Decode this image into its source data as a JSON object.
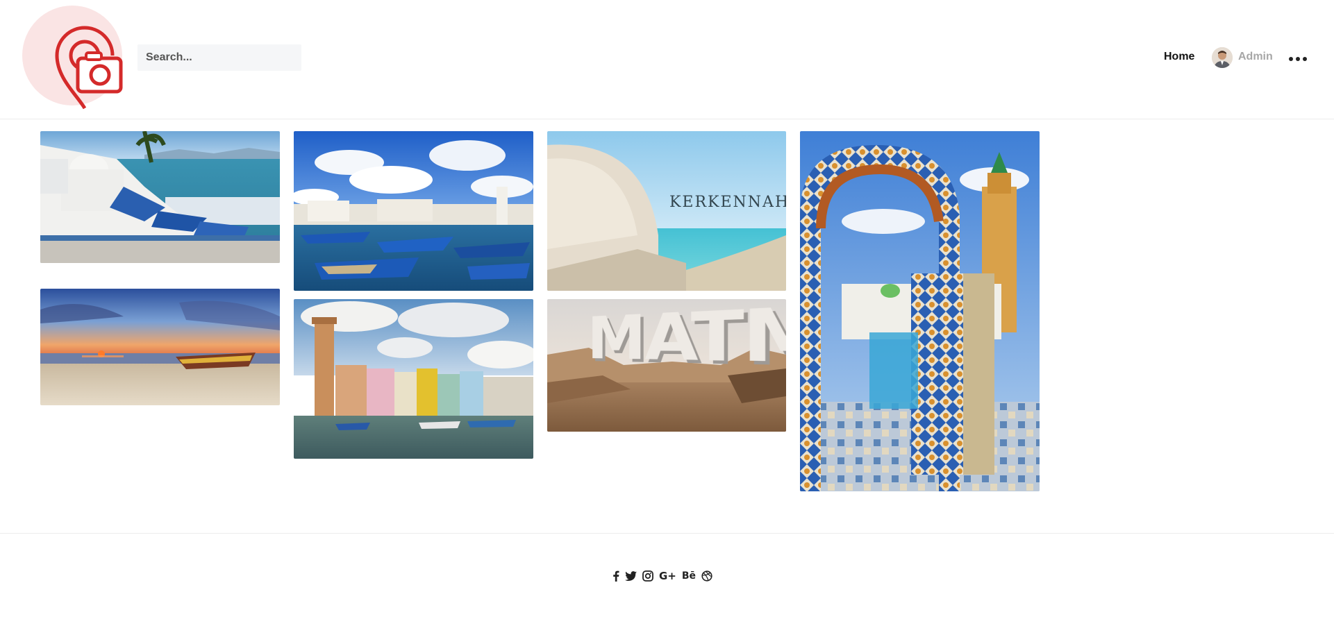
{
  "header": {
    "search_placeholder": "Search...",
    "nav_home": "Home",
    "user_name": "Admin"
  },
  "gallery": [
    {
      "caption": ""
    },
    {
      "caption": ""
    },
    {
      "caption": "Kerkennah"
    },
    {
      "caption": ""
    },
    {
      "caption": ""
    },
    {
      "caption": ""
    },
    {
      "caption": "MATMATA"
    }
  ],
  "footer": {
    "social": [
      "facebook-icon",
      "twitter-icon",
      "instagram-icon",
      "google-plus-icon",
      "behance-icon",
      "dribbble-icon"
    ],
    "google_label": "G+",
    "behance_label": "Bē"
  },
  "colors": {
    "logo_red": "#d42a2a",
    "logo_pink": "#fae4e4",
    "header_border": "#ececec"
  }
}
